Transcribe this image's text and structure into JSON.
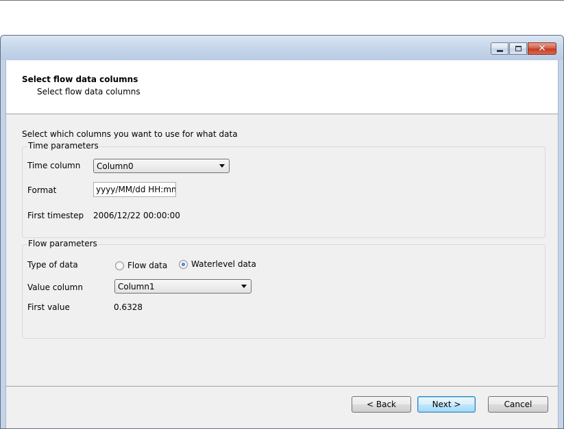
{
  "window": {
    "caption_buttons": {
      "minimize_icon": "minimize-icon",
      "maximize_icon": "maximize-icon",
      "close_icon": "close-icon",
      "close_glyph": "✕"
    }
  },
  "header": {
    "title": "Select flow data columns",
    "subtitle": "Select flow data columns"
  },
  "instruction": "Select which columns you want to use for what data",
  "time_parameters": {
    "group_label": "Time parameters",
    "time_column_label": "Time column",
    "time_column_value": "Column0",
    "format_label": "Format",
    "format_value": "yyyy/MM/dd HH:mn",
    "first_timestep_label": "First timestep",
    "first_timestep_value": "2006/12/22 00:00:00"
  },
  "flow_parameters": {
    "group_label": "Flow parameters",
    "type_of_data_label": "Type of data",
    "radio_flow_label": "Flow data",
    "radio_waterlevel_label": "Waterlevel data",
    "selected_type": "Waterlevel data",
    "value_column_label": "Value column",
    "value_column_value": "Column1",
    "first_value_label": "First value",
    "first_value_value": "0.6328"
  },
  "footer": {
    "back_label": "< Back",
    "next_label": "Next >",
    "cancel_label": "Cancel"
  },
  "colors": {
    "titlebar": "#c6d6ea",
    "client_bg": "#f0f0f0",
    "close_button": "#c23a24",
    "default_button": "#bee6fd"
  }
}
